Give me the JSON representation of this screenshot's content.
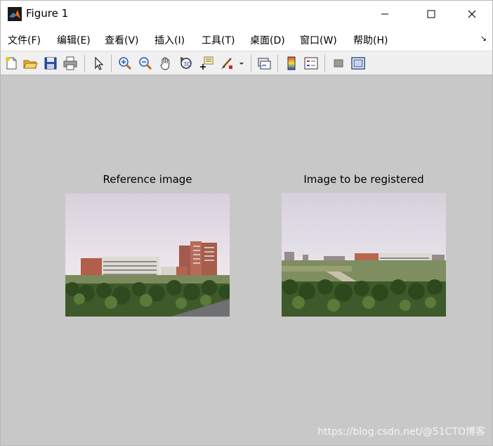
{
  "window": {
    "title": "Figure 1"
  },
  "menu": [
    {
      "label": "文件(F)"
    },
    {
      "label": "编辑(E)"
    },
    {
      "label": "查看(V)"
    },
    {
      "label": "插入(I)"
    },
    {
      "label": "工具(T)"
    },
    {
      "label": "桌面(D)"
    },
    {
      "label": "窗口(W)"
    },
    {
      "label": "帮助(H)"
    }
  ],
  "toolbar": {
    "icons": [
      "new-figure-icon",
      "open-file-icon",
      "save-icon",
      "print-icon",
      "select-pointer-icon",
      "zoom-in-icon",
      "zoom-out-icon",
      "pan-hand-icon",
      "rotate-3d-icon",
      "data-cursor-icon",
      "brush-icon",
      "brush-dropdown-icon",
      "link-plot-icon",
      "colorbar-icon",
      "legend-icon",
      "hide-plot-tools-icon",
      "show-plot-tools-icon"
    ]
  },
  "axes": {
    "left_title": "Reference image",
    "right_title": "Image to be registered"
  },
  "watermark": "https://blog.csdn.net/@51CTO博客",
  "colors": {
    "figure_bg": "#c8c8c8",
    "toolbar_bg": "#f0f0f0",
    "titlebar_bg": "#ffffff"
  }
}
